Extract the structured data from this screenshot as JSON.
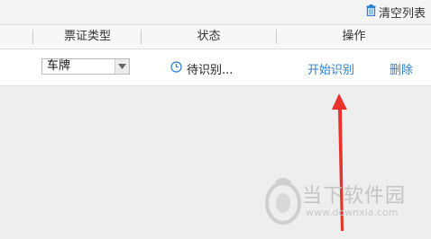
{
  "toolbar": {
    "clear_list_label": "清空列表",
    "clear_icon": "trash-icon"
  },
  "table": {
    "headers": [
      "票证类型",
      "状态",
      "操作"
    ],
    "rows": [
      {
        "ticket_type": "车牌",
        "status": "待识别...",
        "status_icon": "clock-icon",
        "actions": [
          "开始识别",
          "删除"
        ]
      }
    ]
  },
  "watermark": {
    "name": "当下软件园",
    "url": "www.downxia.com"
  },
  "colors": {
    "link": "#2a7fd0",
    "annotation_arrow": "#e8322c"
  }
}
